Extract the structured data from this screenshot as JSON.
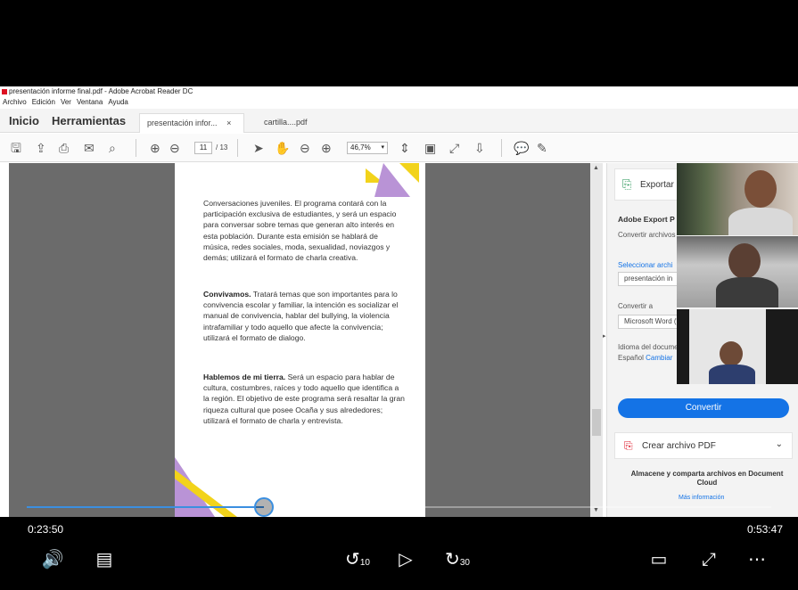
{
  "app": {
    "window_title": "presentación informe final.pdf - Adobe Acrobat Reader DC",
    "menu": [
      "Archivo",
      "Edición",
      "Ver",
      "Ventana",
      "Ayuda"
    ]
  },
  "tabs": {
    "home": "Inicio",
    "tools": "Herramientas",
    "doc_active": "presentación infor...",
    "doc_active_close": "×",
    "doc_other": "cartilla....pdf"
  },
  "toolbar": {
    "page_current": "11",
    "page_total": "/ 13",
    "zoom": "46,7%"
  },
  "document": {
    "p1": "Conversaciones juveniles.  El programa contará con la participación exclusiva de estudiantes, y será un espacio para conversar sobre temas que generan alto interés en esta población. Durante esta emisión se hablará de música, redes sociales, moda, sexualidad, noviazgos y demás; utilizará el formato de charla creativa.",
    "p2_bold": "Convivamos.",
    "p2": " Tratará temas que son importantes para lo convivencia escolar y familiar, la intención es socializar el manual de convivencia, hablar del bullying, la violencia intrafamiliar y todo aquello que afecte la convivencia; utilizará el formato de dialogo.",
    "p3_bold": "Hablemos de mi tierra.",
    "p3": " Será un espacio para hablar de cultura, costumbres, raíces y todo aquello que identifica a la región. El objetivo de este programa será resaltar la gran riqueza cultural que posee Ocaña y sus alrededores; utilizará el formato de charla y entrevista."
  },
  "right_panel": {
    "export_title": "Exportar",
    "adobe_export": "Adobe Export P",
    "convert_files": "Convertir archivos",
    "select_file": "Seleccionar archi",
    "selected_file": "presentación in",
    "convert_to": "Convertir a",
    "format": "Microsoft Word (*.docx)",
    "doc_language_label": "Idioma del documento:",
    "doc_language": "Español",
    "change_link": "Cambiar",
    "convert_button": "Convertir",
    "create_pdf": "Crear archivo PDF",
    "store_share": "Almacene y comparta archivos en Document Cloud",
    "more_info": "Más información"
  },
  "player": {
    "current_time": "0:23:50",
    "total_time": "0:53:47",
    "progress_fraction": 0.318,
    "rewind_label": "10",
    "forward_label": "30"
  },
  "colors": {
    "accent_blue": "#1473e6",
    "progress_blue": "#3b8fe0",
    "triangle_yellow": "#f2d31b",
    "triangle_purple": "#b993d6"
  }
}
